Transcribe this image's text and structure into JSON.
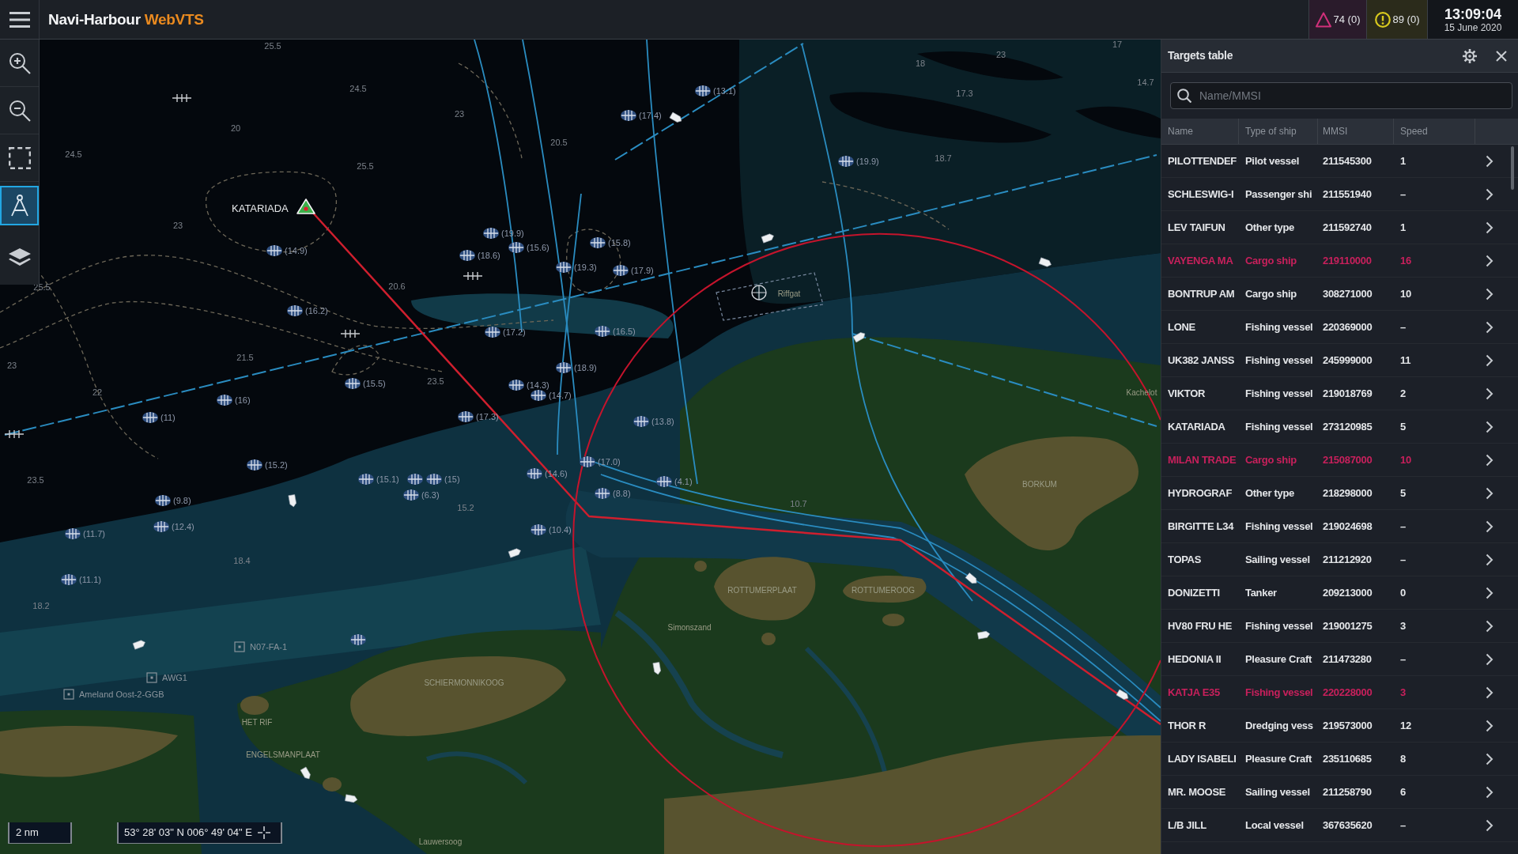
{
  "header": {
    "title": "Navi-Harbour",
    "title_accent": "WebVTS",
    "counters": [
      {
        "kind": "alarm",
        "text": "74 (0)"
      },
      {
        "kind": "warning",
        "text": "89 (0)"
      }
    ],
    "time": "13:09:04",
    "date": "15 June 2020"
  },
  "toolbar": [
    {
      "kind": "zoom-in",
      "selected": false
    },
    {
      "kind": "zoom-out",
      "selected": false
    },
    {
      "kind": "select-area",
      "selected": false
    },
    {
      "kind": "measure",
      "selected": true
    },
    {
      "kind": "layers",
      "selected": false
    }
  ],
  "map": {
    "target": {
      "label": "KATARIADA"
    },
    "depths": [
      "25.5",
      "24.5",
      "20",
      "24.5",
      "25.5",
      "23",
      "25.5",
      "23",
      "20.5",
      "20.6",
      "23.5",
      "15.2",
      "10.7",
      "22",
      "23.5",
      "18.4",
      "18.2",
      "18",
      "23",
      "17",
      "17.3",
      "14.7",
      "18.7",
      "23",
      "21.5"
    ],
    "buoy_labels": [
      "(14.9)",
      "(16.2)",
      "(16)",
      "(11)",
      "(15.2)",
      "(9.8)",
      "(12.4)",
      "(11.7)",
      "(11.1)",
      "(15.5)",
      "(15.1)",
      "(15)",
      "(6.3)",
      "(17.3)",
      "(19.9)",
      "(18.6)",
      "(15.6)",
      "(19.3)",
      "(15.8)",
      "(17.9)",
      "(17.2)",
      "(16.5)",
      "(18.9)",
      "(14.3)",
      "(14.7)",
      "(13.8)",
      "(17.0)",
      "(14.6)",
      "(8.8)",
      "(4.1)",
      "(10.4)",
      "(17.4)",
      "(13.1)",
      "(19.9)"
    ],
    "places": [
      {
        "kind": "area",
        "label": "Riffgat"
      },
      {
        "kind": "station",
        "label": "N07-FA-1"
      },
      {
        "kind": "station",
        "label": "AWG1"
      },
      {
        "kind": "station",
        "label": "Ameland Oost-2-GGB"
      },
      {
        "kind": "area",
        "label": "SCHIERMONNIKOOG"
      },
      {
        "kind": "area",
        "label": "HET RIF"
      },
      {
        "kind": "area",
        "label": "ENGELSMANPLAAT"
      },
      {
        "kind": "area",
        "label": "Kachelot"
      },
      {
        "kind": "area",
        "label": "BORKUM"
      },
      {
        "kind": "area",
        "label": "ROTTUMERPLAAT"
      },
      {
        "kind": "area",
        "label": "ROTTUMEROOG"
      },
      {
        "kind": "area",
        "label": "Simonszand"
      },
      {
        "kind": "area",
        "label": "Lauwersoog"
      }
    ]
  },
  "scale": "2 nm",
  "cursor_position": "53° 28' 03\" N 006° 49' 04\" E",
  "targets_table": {
    "title": "Targets table",
    "search": {
      "placeholder": "Name/MMSI"
    },
    "columns": [
      "Name",
      "Type of ship",
      "MMSI",
      "Speed"
    ],
    "rows": [
      {
        "name": "PILOTTENDEF",
        "type": "Pilot vessel",
        "mmsi": "211545300",
        "speed": "1",
        "alarm": false
      },
      {
        "name": "SCHLESWIG-I",
        "type": "Passenger shi",
        "mmsi": "211551940",
        "speed": "–",
        "alarm": false
      },
      {
        "name": "LEV TAIFUN",
        "type": "Other type",
        "mmsi": "211592740",
        "speed": "1",
        "alarm": false
      },
      {
        "name": "VAYENGA MA",
        "type": "Cargo ship",
        "mmsi": "219110000",
        "speed": "16",
        "alarm": true
      },
      {
        "name": "BONTRUP AM",
        "type": "Cargo ship",
        "mmsi": "308271000",
        "speed": "10",
        "alarm": false
      },
      {
        "name": "LONE",
        "type": "Fishing vessel",
        "mmsi": "220369000",
        "speed": "–",
        "alarm": false
      },
      {
        "name": "UK382 JANSS",
        "type": "Fishing vessel",
        "mmsi": "245999000",
        "speed": "11",
        "alarm": false
      },
      {
        "name": "VIKTOR",
        "type": "Fishing vessel",
        "mmsi": "219018769",
        "speed": "2",
        "alarm": false
      },
      {
        "name": "KATARIADA",
        "type": "Fishing vessel",
        "mmsi": "273120985",
        "speed": "5",
        "alarm": false
      },
      {
        "name": "MILAN TRADE",
        "type": "Cargo ship",
        "mmsi": "215087000",
        "speed": "10",
        "alarm": true
      },
      {
        "name": "HYDROGRAF",
        "type": "Other type",
        "mmsi": "218298000",
        "speed": "5",
        "alarm": false
      },
      {
        "name": "BIRGITTE L34",
        "type": "Fishing vessel",
        "mmsi": "219024698",
        "speed": "–",
        "alarm": false
      },
      {
        "name": "TOPAS",
        "type": "Sailing vessel",
        "mmsi": "211212920",
        "speed": "–",
        "alarm": false
      },
      {
        "name": "DONIZETTI",
        "type": "Tanker",
        "mmsi": "209213000",
        "speed": "0",
        "alarm": false
      },
      {
        "name": "HV80 FRU HE",
        "type": "Fishing vessel",
        "mmsi": "219001275",
        "speed": "3",
        "alarm": false
      },
      {
        "name": "HEDONIA II",
        "type": "Pleasure Craft",
        "mmsi": "211473280",
        "speed": "–",
        "alarm": false
      },
      {
        "name": "KATJA E35",
        "type": "Fishing vessel",
        "mmsi": "220228000",
        "speed": "3",
        "alarm": true
      },
      {
        "name": "THOR R",
        "type": "Dredging vess",
        "mmsi": "219573000",
        "speed": "12",
        "alarm": false
      },
      {
        "name": "LADY ISABELI",
        "type": "Pleasure Craft",
        "mmsi": "235110685",
        "speed": "8",
        "alarm": false
      },
      {
        "name": "MR. MOOSE",
        "type": "Sailing vessel",
        "mmsi": "211258790",
        "speed": "6",
        "alarm": false
      },
      {
        "name": "L/B JILL",
        "type": "Local vessel",
        "mmsi": "367635620",
        "speed": "–",
        "alarm": false
      }
    ]
  }
}
